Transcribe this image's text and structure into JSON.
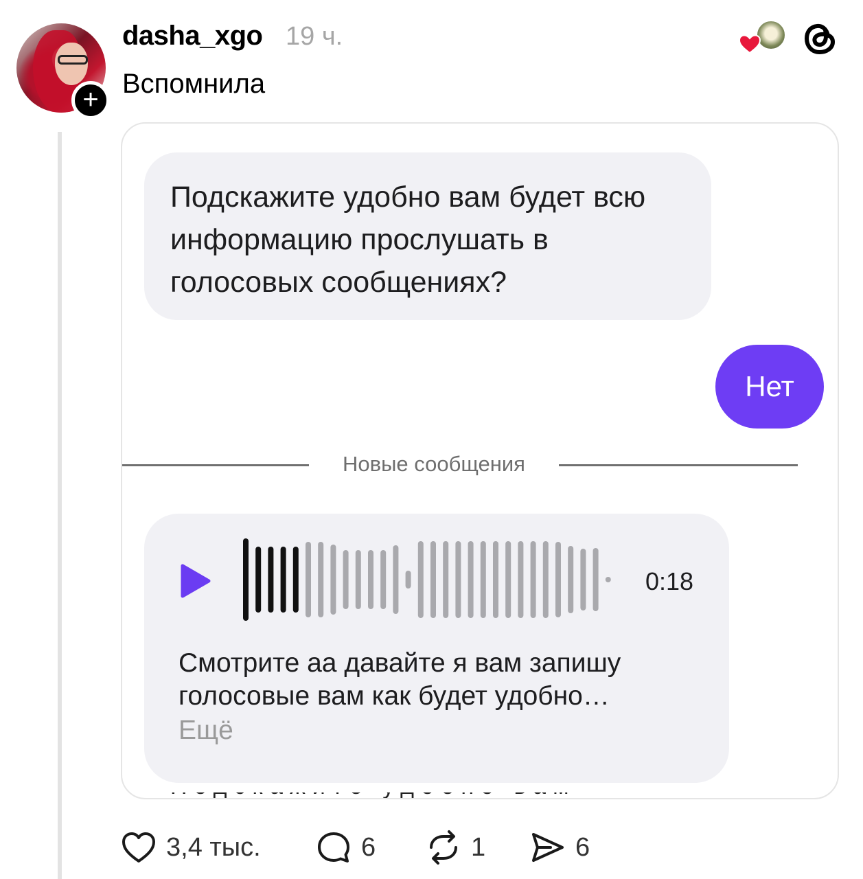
{
  "post": {
    "username": "dasha_xgo",
    "timestamp": "19 ч.",
    "caption": "Вспомнила",
    "follow_symbol": "+"
  },
  "chat": {
    "incoming_message": "Подскажите удобно вам будет всю информацию прослушать в голосовых сообщениях?",
    "outgoing_message": "Нет",
    "divider_label": "Новые сообщения",
    "voice_message": {
      "duration": "0:18",
      "transcript": "Смотрите аа давайте я вам запишу голосовые вам как будет удобно…",
      "more_label": "Ещё"
    },
    "cutoff_text": "Подскажите удобно вам будет удобно"
  },
  "actions": {
    "likes": "3,4 тыс.",
    "replies": "6",
    "reposts": "1",
    "shares": "6"
  },
  "colors": {
    "accent_purple": "#6e3df4",
    "play_purple": "#6b3cf2",
    "bubble_gray": "#f1f1f5",
    "heart_red": "#e8173b"
  },
  "icons": [
    "heart-icon",
    "reply-icon",
    "repost-icon",
    "share-icon",
    "threads-logo-icon",
    "play-icon"
  ]
}
